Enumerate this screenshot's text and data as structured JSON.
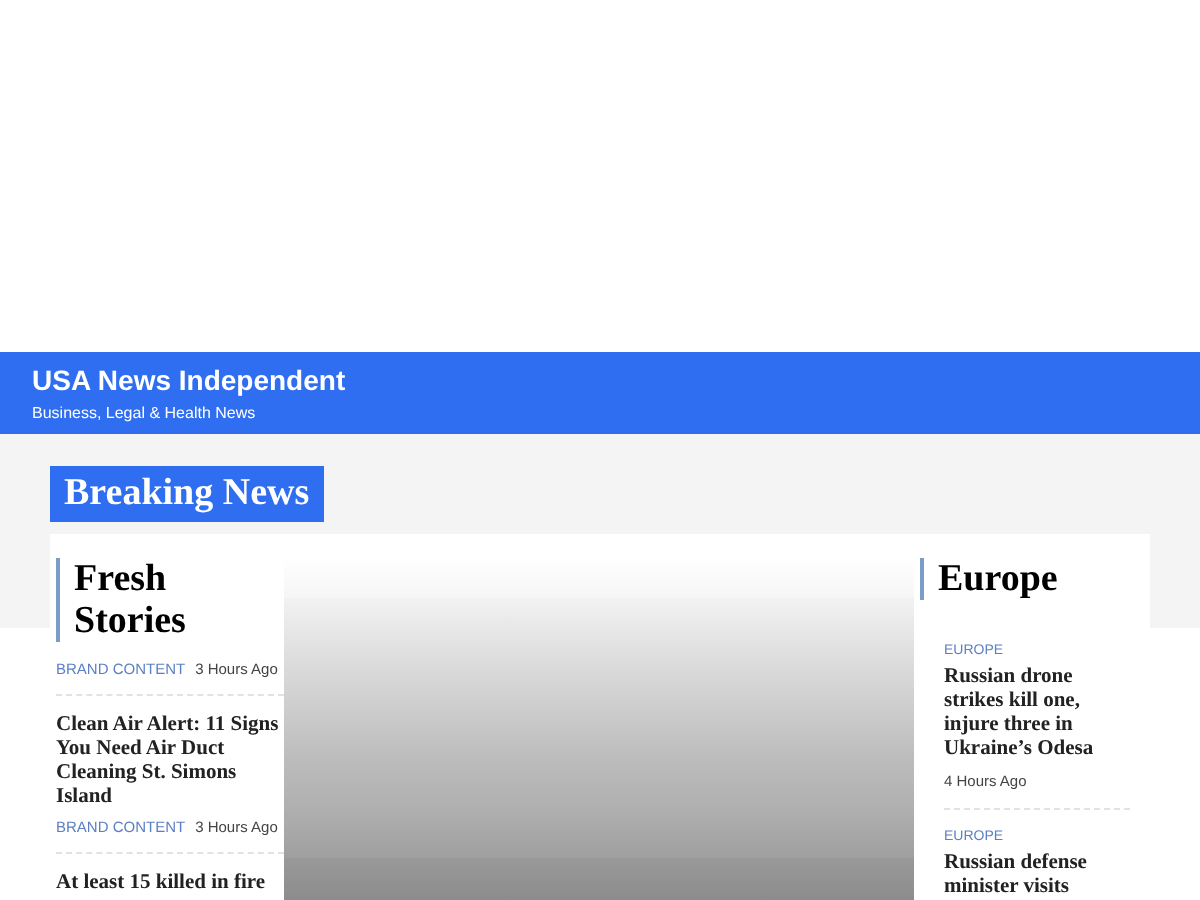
{
  "site": {
    "title": "USA News Independent",
    "tagline": "Business, Legal & Health News"
  },
  "section_title": "Breaking News",
  "fresh_stories": {
    "heading": "Fresh Stories",
    "items": [
      {
        "category": "BRAND CONTENT",
        "time": "3 Hours Ago"
      },
      {
        "title": "Clean Air Alert: 11 Signs You Need Air Duct Cleaning St. Simons Island",
        "category": "BRAND CONTENT",
        "time": "3 Hours Ago"
      },
      {
        "title": "At least 15 killed in fire"
      }
    ]
  },
  "europe": {
    "heading": "Europe",
    "items": [
      {
        "category": "EUROPE",
        "title": "Russian drone strikes kill one, injure three in Ukraine’s Odesa",
        "time": "4 Hours Ago"
      },
      {
        "category": "EUROPE",
        "title": "Russian defense minister visits"
      }
    ]
  }
}
